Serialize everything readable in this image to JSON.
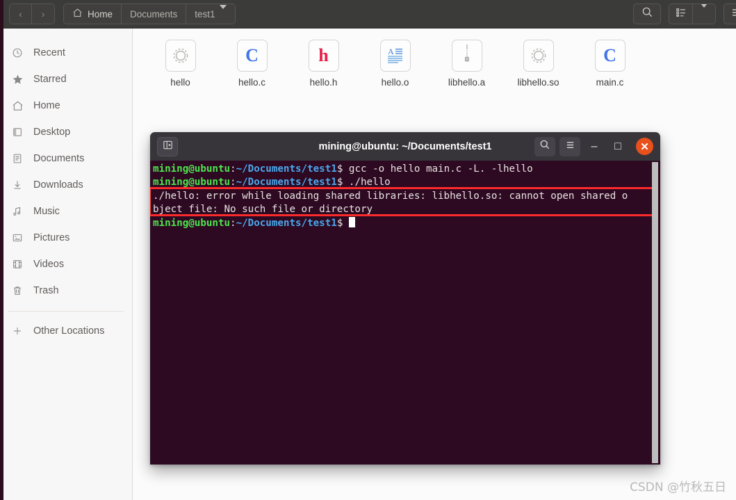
{
  "window": {
    "app": "files-manager"
  },
  "toolbar": {
    "back_icon": "chevron-left-icon",
    "forward_icon": "chevron-right-icon",
    "back_glyph": "‹",
    "forward_glyph": "›",
    "breadcrumbs": [
      {
        "label": "Home",
        "icon": "home-icon"
      },
      {
        "label": "Documents",
        "icon": ""
      },
      {
        "label": "test1",
        "icon": "",
        "has_caret": true
      }
    ],
    "search_label": "search-icon",
    "list_view_label": "list-view-icon",
    "view_caret_label": "chevron-down-icon",
    "menu_label": "hamburger-menu-icon"
  },
  "sidebar": {
    "items": [
      {
        "label": "Recent",
        "icon": "clock-icon"
      },
      {
        "label": "Starred",
        "icon": "star-icon"
      },
      {
        "label": "Home",
        "icon": "home-icon"
      },
      {
        "label": "Desktop",
        "icon": "desktop-icon"
      },
      {
        "label": "Documents",
        "icon": "document-icon"
      },
      {
        "label": "Downloads",
        "icon": "download-icon"
      },
      {
        "label": "Music",
        "icon": "music-note-icon"
      },
      {
        "label": "Pictures",
        "icon": "picture-icon"
      },
      {
        "label": "Videos",
        "icon": "film-icon"
      },
      {
        "label": "Trash",
        "icon": "trash-icon"
      }
    ],
    "other_locations": {
      "label": "Other Locations",
      "icon": "plus-icon"
    }
  },
  "files": [
    {
      "name": "hello",
      "icon": "gear-executable-icon",
      "glyph": "⚙",
      "color": "#b8b6b4"
    },
    {
      "name": "hello.c",
      "icon": "c-source-icon",
      "glyph": "C",
      "color": "#4175e8"
    },
    {
      "name": "hello.h",
      "icon": "h-header-icon",
      "glyph": "h",
      "color": "#e8204a"
    },
    {
      "name": "hello.o",
      "icon": "text-document-icon",
      "glyph": "A",
      "color": "#3b7fd4"
    },
    {
      "name": "libhello.a",
      "icon": "archive-icon",
      "glyph": "‖",
      "color": "#9a9896"
    },
    {
      "name": "libhello.so",
      "icon": "gear-executable-icon",
      "glyph": "⚙",
      "color": "#b8b6b4"
    },
    {
      "name": "main.c",
      "icon": "c-source-icon",
      "glyph": "C",
      "color": "#4175e8"
    }
  ],
  "terminal": {
    "title": "mining@ubuntu: ~/Documents/test1",
    "new_tab_icon": "new-tab-icon",
    "search_icon": "search-icon",
    "menu_icon": "hamburger-menu-icon",
    "minimize_glyph": "–",
    "maximize_glyph": "□",
    "close_glyph": "✕",
    "prompt_user": "mining@ubuntu",
    "prompt_colon": ":",
    "prompt_path": "~/Documents/test1",
    "prompt_dollar": "$",
    "lines": [
      {
        "type": "prompt",
        "command": " gcc -o hello main.c -L. -lhello"
      },
      {
        "type": "prompt",
        "command": " ./hello"
      },
      {
        "type": "output",
        "text": "./hello: error while loading shared libraries: libhello.so: cannot open shared o"
      },
      {
        "type": "output",
        "text": "bject file: No such file or directory"
      },
      {
        "type": "prompt",
        "command": " ",
        "cursor": true
      }
    ],
    "highlight_color": "#fb2b2b",
    "background": "#2d0922"
  },
  "watermark": {
    "text": "CSDN @竹秋五日"
  }
}
